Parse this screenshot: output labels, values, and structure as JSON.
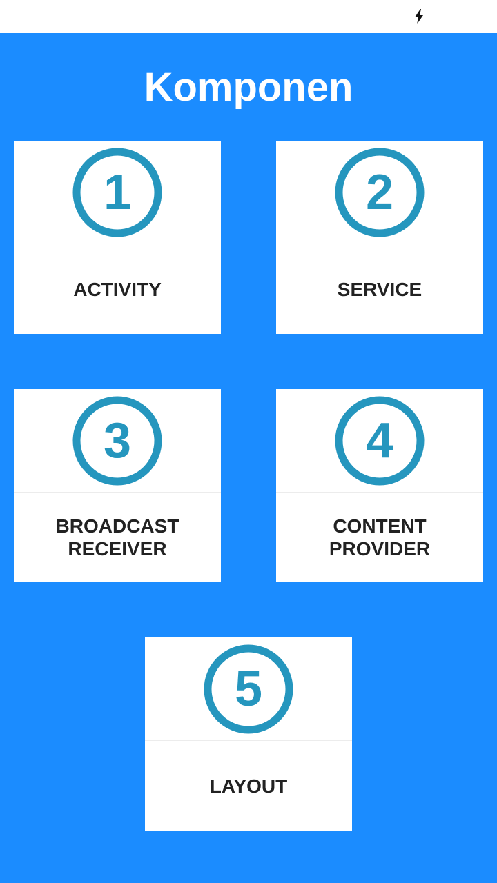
{
  "status_bar": {
    "icons": [
      "charging-bolt-icon"
    ]
  },
  "header": {
    "title": "Komponen"
  },
  "colors": {
    "background": "#1b8cff",
    "card": "#ffffff",
    "number_circle": "#2596be",
    "label": "#222222"
  },
  "cards": [
    {
      "number": "1",
      "label": "ACTIVITY",
      "icon": "number-1-circle-icon"
    },
    {
      "number": "2",
      "label": "SERVICE",
      "icon": "number-2-circle-icon"
    },
    {
      "number": "3",
      "label": "BROADCAST\nRECEIVER",
      "icon": "number-3-circle-icon"
    },
    {
      "number": "4",
      "label": "CONTENT PROVIDER",
      "icon": "number-4-circle-icon"
    },
    {
      "number": "5",
      "label": "LAYOUT",
      "icon": "number-5-circle-icon"
    }
  ]
}
